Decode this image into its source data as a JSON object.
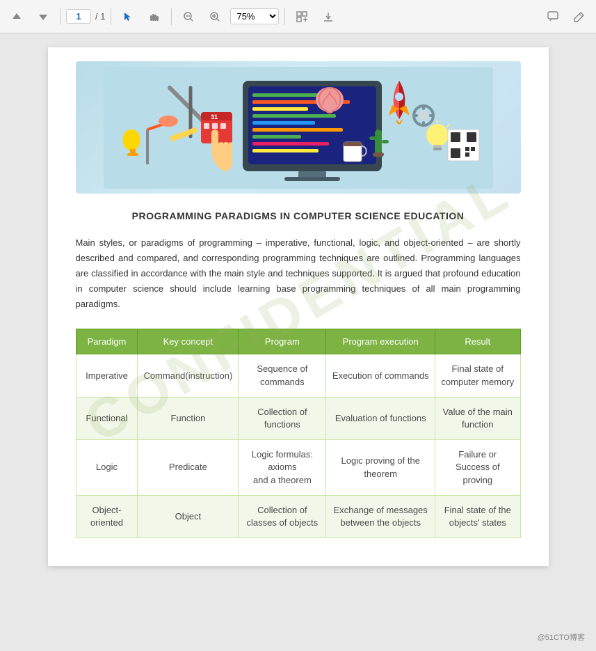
{
  "toolbar": {
    "up_label": "▲",
    "down_label": "▼",
    "page_current": "1",
    "page_sep": "/ 1",
    "cursor_icon": "▲",
    "hand_icon": "✋",
    "zoom_out_icon": "−",
    "zoom_in_icon": "+",
    "zoom_value": "75%",
    "fit_icon": "⊞",
    "download_icon": "⬇",
    "comment_icon": "💬",
    "pen_icon": "✏"
  },
  "page": {
    "title": "PROGRAMMING PARADIGMS IN COMPUTER SCIENCE EDUCATION",
    "body": "Main styles, or paradigms of programming – imperative, functional, logic, and object-oriented – are shortly described and compared, and corresponding programming techniques are outlined. Programming languages are classified in accordance with the main style and techniques supported. It is argued that profound education in computer science should include learning base programming techniques of all main programming paradigms.",
    "watermark": "CONFIDENTIAL"
  },
  "table": {
    "headers": [
      "Paradigm",
      "Key concept",
      "Program",
      "Program execution",
      "Result"
    ],
    "rows": [
      {
        "paradigm": "Imperative",
        "key_concept": "Command(instruction)",
        "program": "Sequence of commands",
        "execution": "Execution of commands",
        "result": "Final state of computer memory"
      },
      {
        "paradigm": "Functional",
        "key_concept": "Function",
        "program": "Collection of functions",
        "execution": "Evaluation of functions",
        "result": "Value of the main function"
      },
      {
        "paradigm": "Logic",
        "key_concept": "Predicate",
        "program": "Logic formulas: axioms\nand a theorem",
        "execution": "Logic proving of the theorem",
        "result": "Failure or Success of proving"
      },
      {
        "paradigm": "Object-oriented",
        "key_concept": "Object",
        "program": "Collection of classes of objects",
        "execution": "Exchange of messages between the objects",
        "result": "Final state of the objects' states"
      }
    ]
  },
  "attribution": "@51CTO博客"
}
